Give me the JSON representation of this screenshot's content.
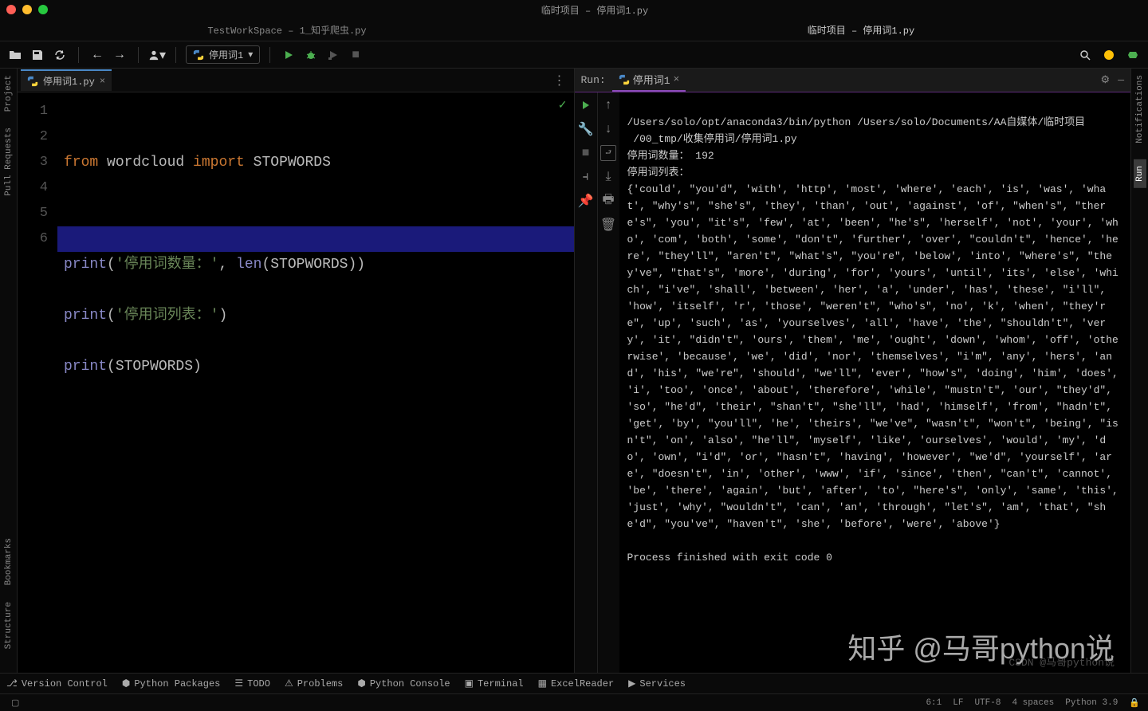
{
  "titlebar": {
    "title": "临时项目 – 停用词1.py"
  },
  "projectTabs": {
    "left": "TestWorkSpace – 1_知乎爬虫.py",
    "right": "临时项目 – 停用词1.py"
  },
  "toolbar": {
    "runConfig": "停用词1"
  },
  "fileTab": {
    "name": "停用词1.py"
  },
  "code": {
    "lines": [
      "1",
      "2",
      "3",
      "4",
      "5",
      "6"
    ],
    "l1_kw1": "from",
    "l1_name1": " wordcloud ",
    "l1_kw2": "import",
    "l1_name2": " STOPWORDS",
    "l3_fn": "print",
    "l3_p1": "(",
    "l3_str": "'停用词数量：'",
    "l3_c": ", ",
    "l3_len": "len",
    "l3_p2": "(STOPWORDS))",
    "l4_fn": "print",
    "l4_p1": "(",
    "l4_str": "'停用词列表：'",
    "l4_p2": ")",
    "l5_fn": "print",
    "l5_p1": "(STOPWORDS)"
  },
  "run": {
    "label": "Run:",
    "tab": "停用词1",
    "cmd": "/Users/solo/opt/anaconda3/bin/python /Users/solo/Documents/AA自媒体/临时项目",
    "cmd2": " /00_tmp/收集停用词/停用词1.py",
    "out1": "停用词数量： 192",
    "out2": "停用词列表：",
    "set": "{'could', \"you'd\", 'with', 'http', 'most', 'where', 'each', 'is', 'was', 'what', \"why's\", \"she's\", 'they', 'than', 'out', 'against', 'of', \"when's\", \"there's\", 'you', \"it's\", 'few', 'at', 'been', \"he's\", 'herself', 'not', 'your', 'who', 'com', 'both', 'some', \"don't\", 'further', 'over', \"couldn't\", 'hence', 'here', \"they'll\", \"aren't\", \"what's\", \"you're\", 'below', 'into', \"where's\", \"they've\", \"that's\", 'more', 'during', 'for', 'yours', 'until', 'its', 'else', 'which', \"i've\", 'shall', 'between', 'her', 'a', 'under', 'has', 'these', \"i'll\", 'how', 'itself', 'r', 'those', \"weren't\", \"who's\", 'no', 'k', 'when', \"they're\", 'up', 'such', 'as', 'yourselves', 'all', 'have', 'the', \"shouldn't\", 'very', 'it', \"didn't\", 'ours', 'them', 'me', 'ought', 'down', 'whom', 'off', 'otherwise', 'because', 'we', 'did', 'nor', 'themselves', \"i'm\", 'any', 'hers', 'and', 'his', \"we're\", 'should', \"we'll\", 'ever', \"how's\", 'doing', 'him', 'does', 'i', 'too', 'once', 'about', 'therefore', 'while', \"mustn't\", 'our', \"they'd\", 'so', \"he'd\", 'their', \"shan't\", \"she'll\", 'had', 'himself', 'from', \"hadn't\", 'get', 'by', \"you'll\", 'he', 'theirs', \"we've\", \"wasn't\", \"won't\", 'being', \"isn't\", 'on', 'also', \"he'll\", 'myself', 'like', 'ourselves', 'would', 'my', 'do', 'own', \"i'd\", 'or', \"hasn't\", 'having', 'however', \"we'd\", 'yourself', 'are', \"doesn't\", 'in', 'other', 'www', 'if', 'since', 'then', \"can't\", 'cannot', 'be', 'there', 'again', 'but', 'after', 'to', \"here's\", 'only', 'same', 'this', 'just', 'why', \"wouldn't\", 'can', 'an', 'through', \"let's\", 'am', 'that', \"she'd\", \"you've\", \"haven't\", 'she', 'before', 'were', 'above'}",
    "exit": "Process finished with exit code 0"
  },
  "leftRail": {
    "project": "Project",
    "pull": "Pull Requests",
    "bookmarks": "Bookmarks",
    "structure": "Structure"
  },
  "rightRail": {
    "notifications": "Notifications",
    "run": "Run"
  },
  "bottom": {
    "vc": "Version Control",
    "pp": "Python Packages",
    "todo": "TODO",
    "problems": "Problems",
    "pc": "Python Console",
    "term": "Terminal",
    "er": "ExcelReader",
    "sv": "Services"
  },
  "status": {
    "pos": "6:1",
    "lf": "LF",
    "enc": "UTF-8",
    "indent": "4 spaces",
    "py": "Python 3.9"
  },
  "watermark": "知乎 @马哥python说",
  "csdn": "CSDN @马哥python说"
}
